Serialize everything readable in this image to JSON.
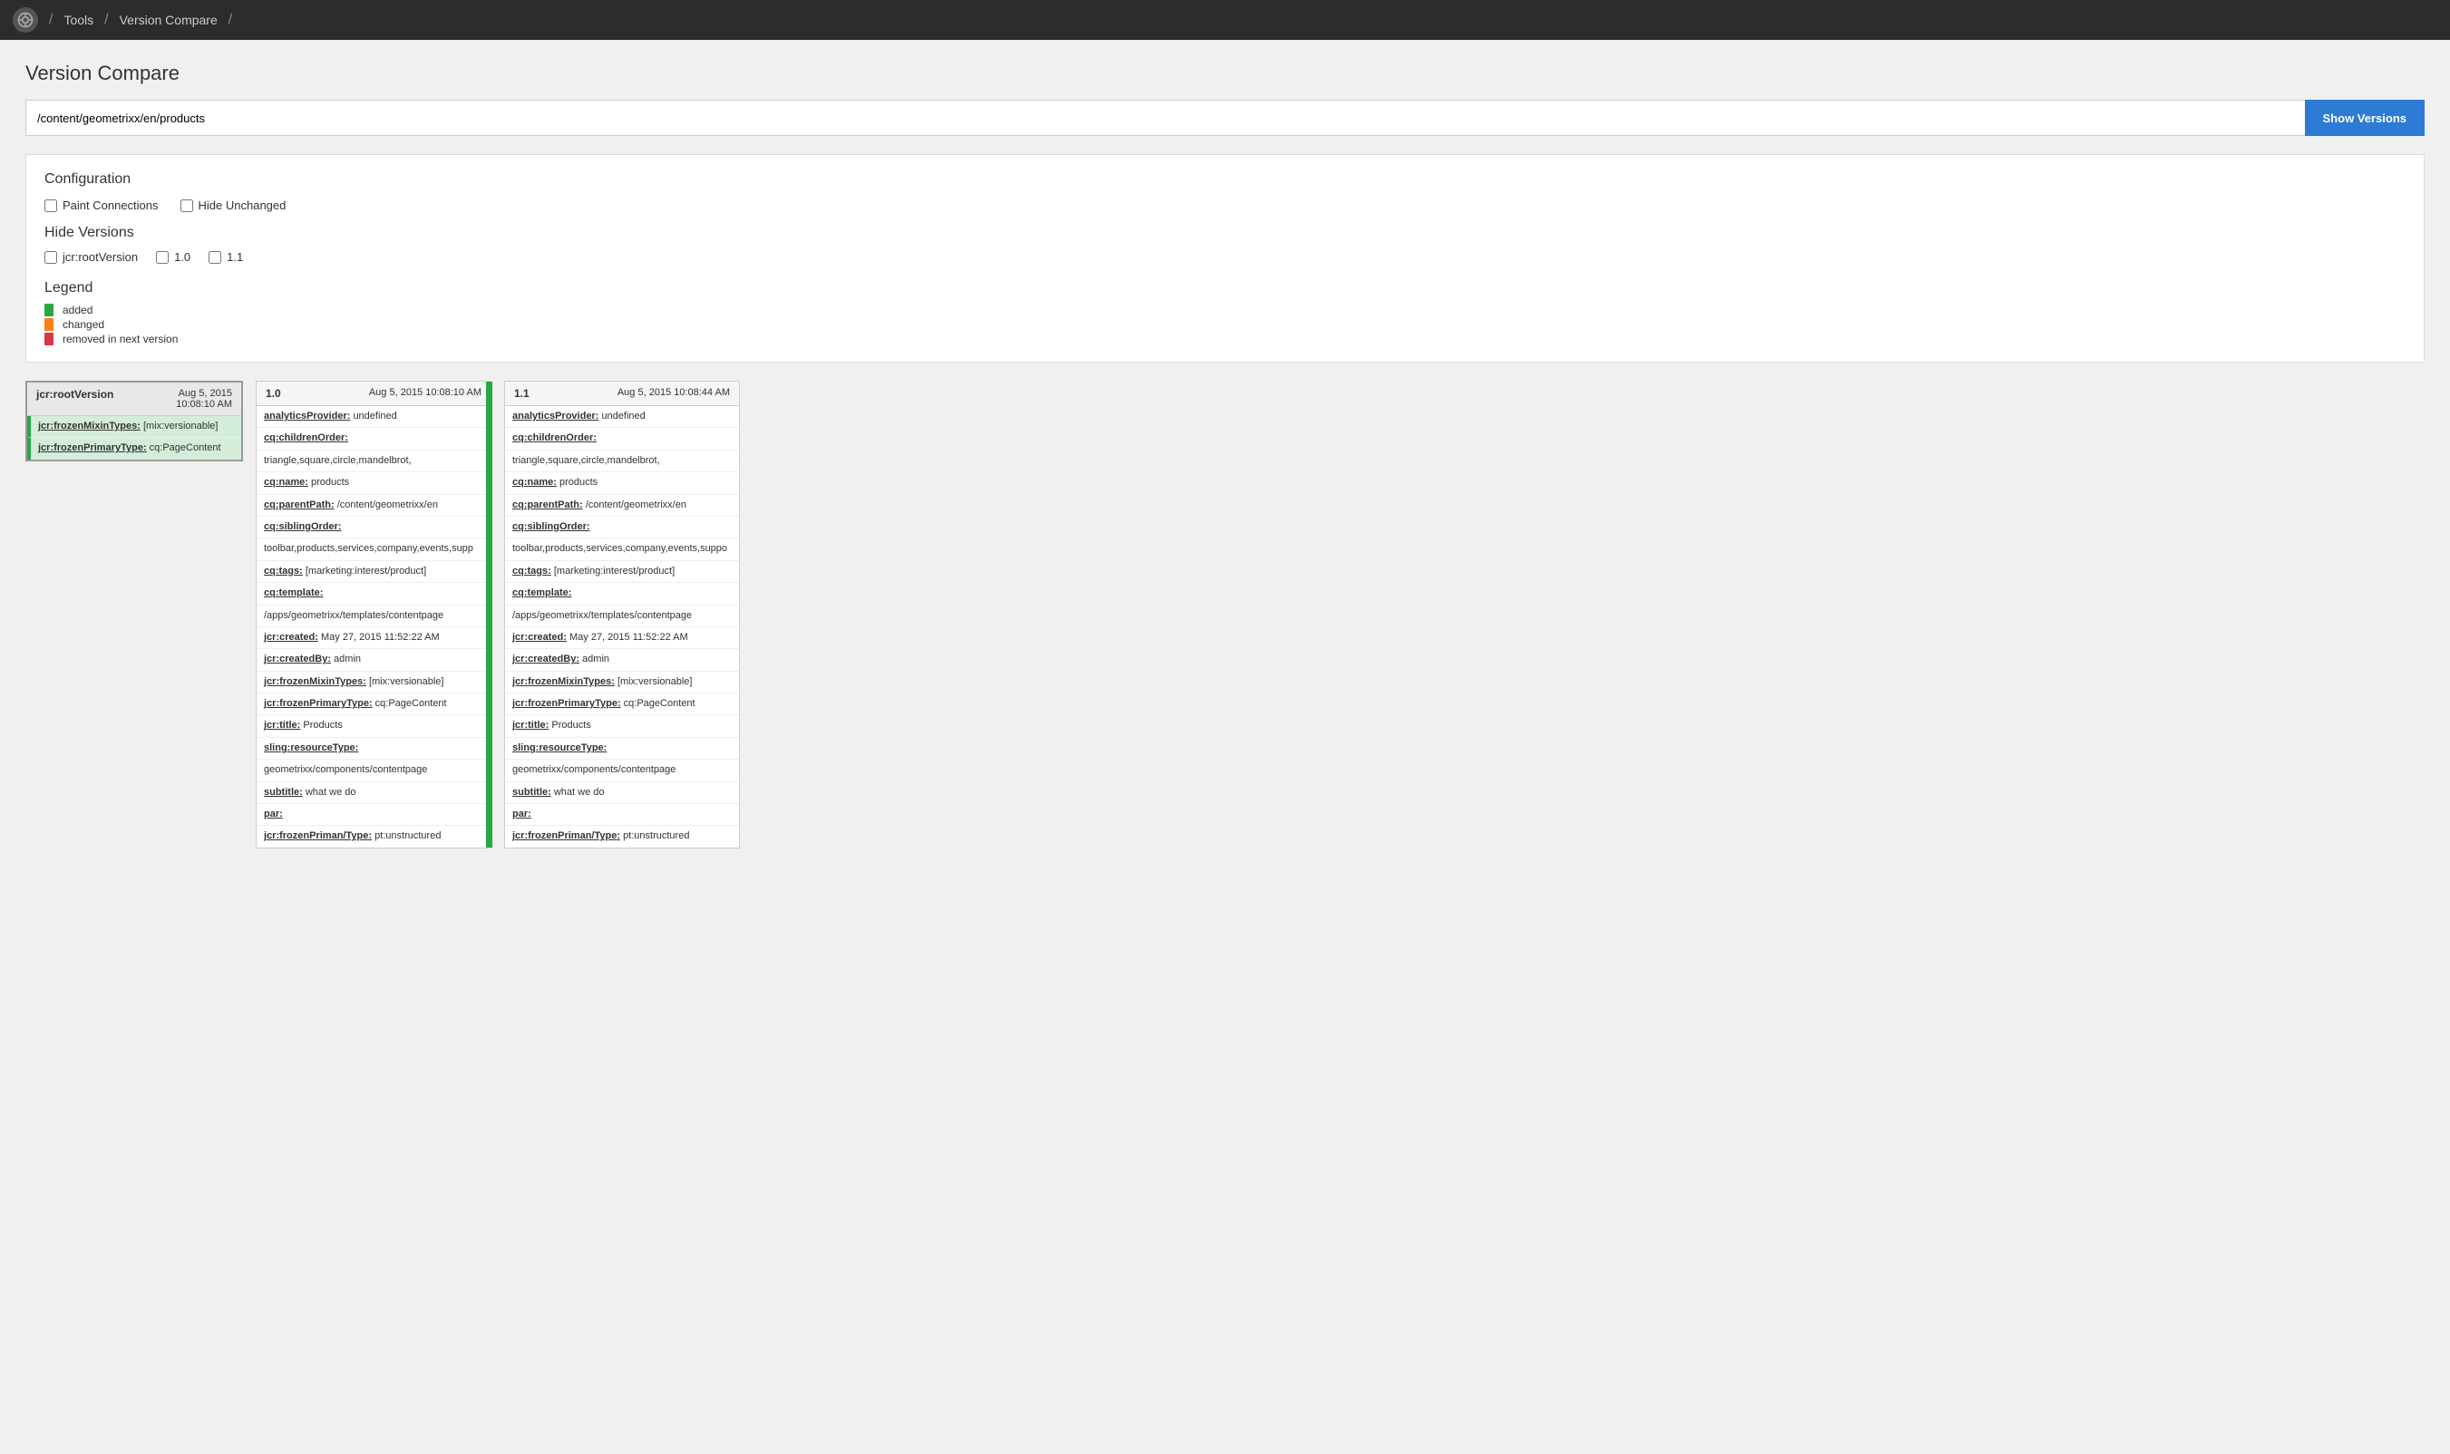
{
  "topnav": {
    "tools_label": "Tools",
    "separator": "/",
    "page_label": "Version Compare"
  },
  "page": {
    "title": "Version Compare"
  },
  "search": {
    "value": "/content/geometrixx/en/products",
    "placeholder": "/content/geometrixx/en/products"
  },
  "buttons": {
    "show_versions": "Show Versions"
  },
  "configuration": {
    "title": "Configuration",
    "paint_connections_label": "Paint Connections",
    "hide_unchanged_label": "Hide Unchanged",
    "hide_versions_title": "Hide Versions",
    "version_jcr": "jcr:rootVersion",
    "version_10": "1.0",
    "version_11": "1.1"
  },
  "legend": {
    "title": "Legend",
    "items": [
      {
        "label": "added",
        "color": "#28a745"
      },
      {
        "label": "changed",
        "color": "#fd7e14"
      },
      {
        "label": "removed in next version",
        "color": "#dc3545"
      }
    ]
  },
  "root_card": {
    "header_label": "jcr:rootVersion",
    "date": "Aug 5, 2015\n10:08:10 AM",
    "rows": [
      {
        "key": "jcr:frozenMixinTypes:",
        "val": " [mix:versionable]",
        "highlight": true
      },
      {
        "key": "jcr:frozenPrimaryType:",
        "val": " cq:PageContent",
        "highlight": true
      }
    ]
  },
  "version_1_card": {
    "header_label": "1.0",
    "date": "Aug 5, 2015 10:08:10 AM",
    "rows": [
      {
        "key": "analyticsProvider:",
        "val": " undefined"
      },
      {
        "key": "cq:childrenOrder:",
        "val": ""
      },
      {
        "key": "",
        "val": "triangle,square,circle,mandelbrot,"
      },
      {
        "key": "cq:name:",
        "val": " products"
      },
      {
        "key": "cq:parentPath:",
        "val": " /content/geometrixx/en"
      },
      {
        "key": "cq:siblingOrder:",
        "val": ""
      },
      {
        "key": "",
        "val": "toolbar,products,services,company,events,supp"
      },
      {
        "key": "cq:tags:",
        "val": " [marketing:interest/product]"
      },
      {
        "key": "cq:template:",
        "val": ""
      },
      {
        "key": "",
        "val": "/apps/geometrixx/templates/contentpage"
      },
      {
        "key": "jcr:created:",
        "val": " May 27, 2015 11:52:22 AM"
      },
      {
        "key": "jcr:createdBy:",
        "val": " admin"
      },
      {
        "key": "jcr:frozenMixinTypes:",
        "val": " [mix:versionable]"
      },
      {
        "key": "jcr:frozenPrimaryType:",
        "val": " cq:PageContent"
      },
      {
        "key": "jcr:title:",
        "val": " Products"
      },
      {
        "key": "sling:resourceType:",
        "val": ""
      },
      {
        "key": "",
        "val": "geometrixx/components/contentpage"
      },
      {
        "key": "subtitle:",
        "val": " what we do"
      },
      {
        "key": "par:",
        "val": ""
      },
      {
        "key": "jcr:frozenPriman/Type:",
        "val": " pt:unstructured"
      }
    ]
  },
  "version_11_card": {
    "header_label": "1.1",
    "date": "Aug 5, 2015 10:08:44 AM",
    "rows": [
      {
        "key": "analyticsProvider:",
        "val": " undefined"
      },
      {
        "key": "cq:childrenOrder:",
        "val": ""
      },
      {
        "key": "",
        "val": "triangle,square,circle,mandelbrot,"
      },
      {
        "key": "cq:name:",
        "val": " products"
      },
      {
        "key": "cq:parentPath:",
        "val": " /content/geometrixx/en"
      },
      {
        "key": "cq:siblingOrder:",
        "val": ""
      },
      {
        "key": "",
        "val": "toolbar,products,services,company,events,suppo"
      },
      {
        "key": "cq:tags:",
        "val": " [marketing:interest/product]"
      },
      {
        "key": "cq:template:",
        "val": ""
      },
      {
        "key": "",
        "val": "/apps/geometrixx/templates/contentpage"
      },
      {
        "key": "jcr:created:",
        "val": " May 27, 2015 11:52:22 AM"
      },
      {
        "key": "jcr:createdBy:",
        "val": " admin"
      },
      {
        "key": "jcr:frozenMixinTypes:",
        "val": " [mix:versionable]"
      },
      {
        "key": "jcr:frozenPrimaryType:",
        "val": " cq:PageContent"
      },
      {
        "key": "jcr:title:",
        "val": " Products"
      },
      {
        "key": "sling:resourceType:",
        "val": ""
      },
      {
        "key": "",
        "val": "geometrixx/components/contentpage"
      },
      {
        "key": "subtitle:",
        "val": " what we do"
      },
      {
        "key": "par:",
        "val": ""
      },
      {
        "key": "jcr:frozenPriman/Type:",
        "val": " pt:unstructured"
      }
    ]
  }
}
